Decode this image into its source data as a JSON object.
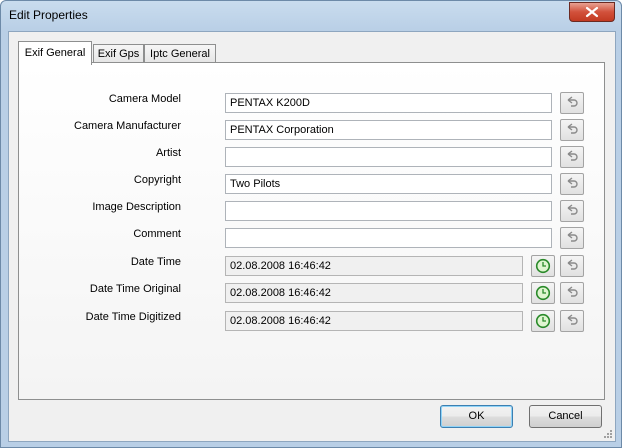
{
  "window": {
    "title": "Edit Properties"
  },
  "tabs": [
    {
      "label": "Exif General",
      "active": true
    },
    {
      "label": "Exif Gps",
      "active": false
    },
    {
      "label": "Iptc General",
      "active": false
    }
  ],
  "fields": {
    "camera_model": {
      "label": "Camera Model",
      "value": "PENTAX K200D"
    },
    "camera_manufacturer": {
      "label": "Camera Manufacturer",
      "value": "PENTAX Corporation"
    },
    "artist": {
      "label": "Artist",
      "value": ""
    },
    "copyright": {
      "label": "Copyright",
      "value": "Two Pilots"
    },
    "image_description": {
      "label": "Image Description",
      "value": ""
    },
    "comment": {
      "label": "Comment",
      "value": ""
    },
    "date_time": {
      "label": "Date Time",
      "value": "02.08.2008 16:46:42"
    },
    "date_time_original": {
      "label": "Date Time Original",
      "value": "02.08.2008 16:46:42"
    },
    "date_time_digitized": {
      "label": "Date Time Digitized",
      "value": "02.08.2008 16:46:42"
    }
  },
  "icons": {
    "revert": "undo-arrow-icon",
    "clock": "clock-icon",
    "close": "close-icon"
  },
  "buttons": {
    "ok": "OK",
    "cancel": "Cancel"
  },
  "colors": {
    "title_bar": "#b9cfe6",
    "close_button": "#c23a22",
    "clock_green": "#2a8a2a"
  }
}
